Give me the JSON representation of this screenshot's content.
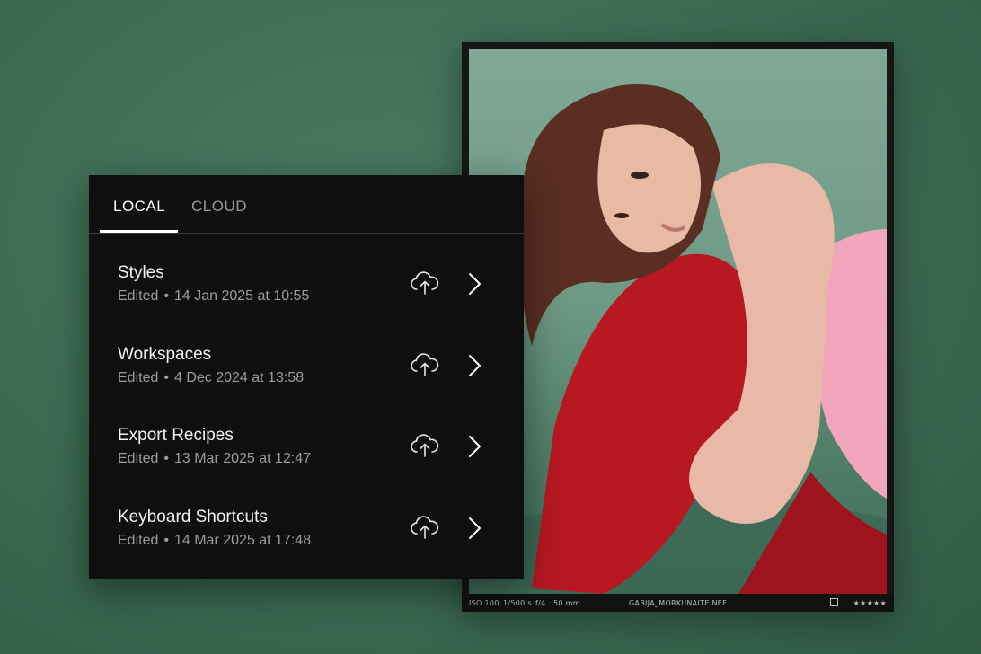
{
  "photo": {
    "info": {
      "iso": "ISO 100",
      "shutter": "1/500 s",
      "aperture": "f/4",
      "focal": "50 mm",
      "filename": "GABIJA_MORKUNAITE.NEF",
      "stars": "★★★★★"
    }
  },
  "panel": {
    "tabs": [
      {
        "label": "LOCAL",
        "active": true
      },
      {
        "label": "CLOUD",
        "active": false
      }
    ],
    "items": [
      {
        "title": "Styles",
        "edited": "Edited",
        "date": "14 Jan 2025 at 10:55"
      },
      {
        "title": "Workspaces",
        "edited": "Edited",
        "date": "4 Dec 2024 at 13:58"
      },
      {
        "title": "Export Recipes",
        "edited": "Edited",
        "date": "13 Mar 2025 at 12:47"
      },
      {
        "title": "Keyboard Shortcuts",
        "edited": "Edited",
        "date": "14 Mar 2025 at 17:48"
      }
    ]
  },
  "colors": {
    "background": "#3b6a52",
    "panel": "#0f0f0f",
    "accent": "#ffffff"
  }
}
